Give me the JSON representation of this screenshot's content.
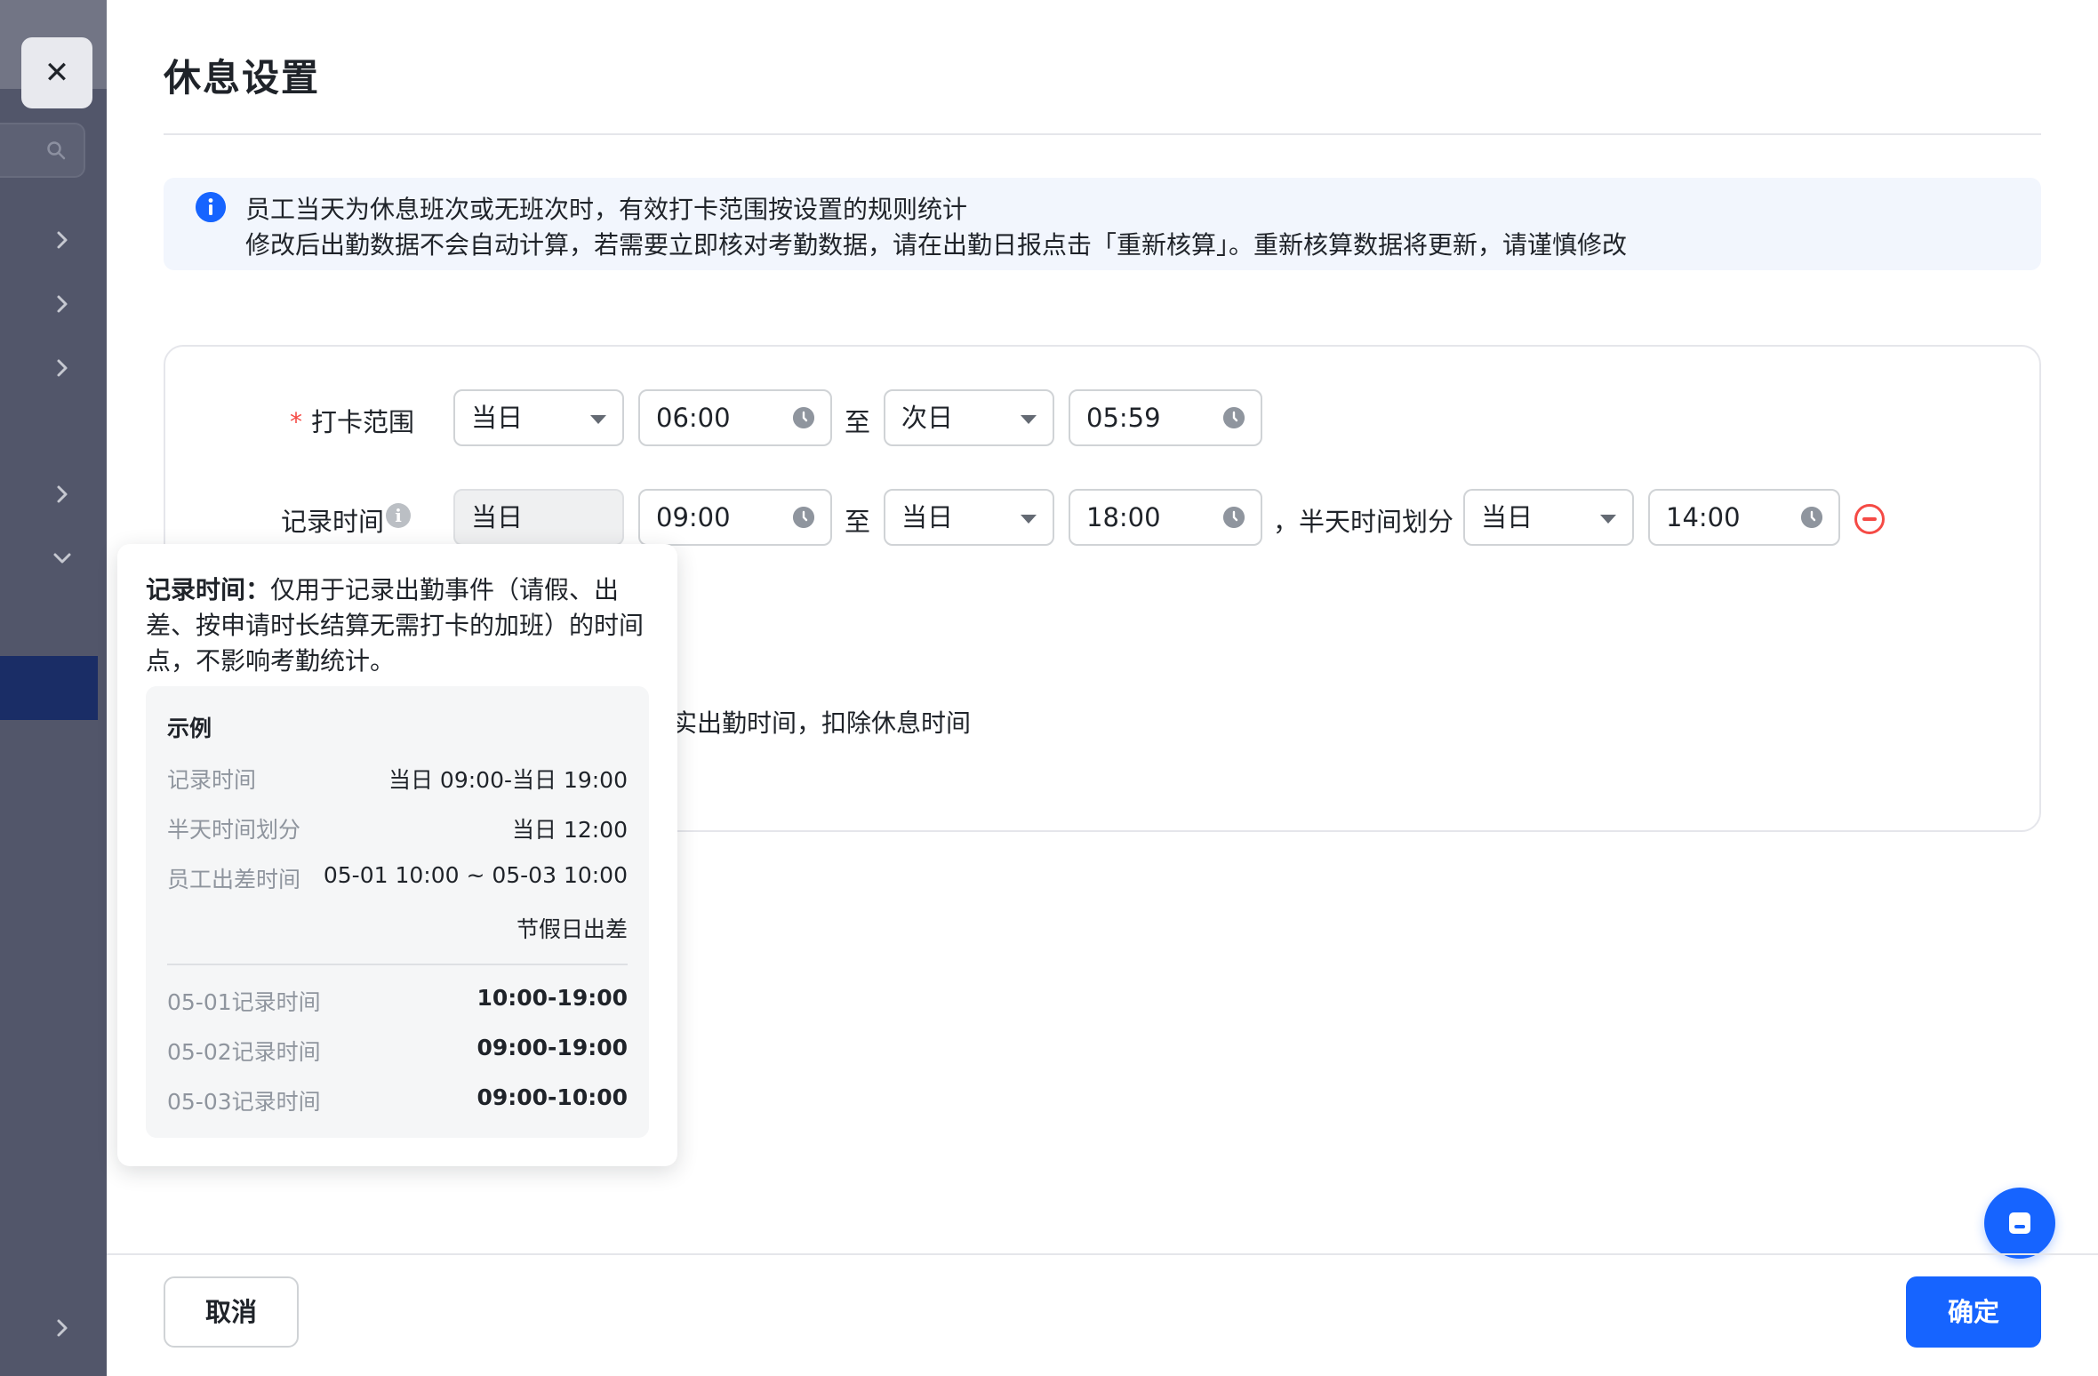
{
  "page": {
    "title": "休息设置",
    "close_glyph": "✕"
  },
  "notice": {
    "line1": "员工当天为休息班次或无班次时，有效打卡范围按设置的规则统计",
    "line2": "修改后出勤数据不会自动计算，若需要立即核对考勤数据，请在出勤日报点击「重新核算」。重新核算数据将更新，请谨慎修改"
  },
  "form": {
    "punch_range": {
      "required_mark": "*",
      "label": "打卡范围",
      "start_day": "当日",
      "start_time": "06:00",
      "to": "至",
      "end_day": "次日",
      "end_time": "05:59"
    },
    "record_time": {
      "label": "记录时间",
      "help_glyph": "i",
      "start_day": "当日",
      "start_time": "09:00",
      "to": "至",
      "end_day": "当日",
      "end_time": "18:00",
      "half_day_label": "，半天时间划分",
      "half_day": "当日",
      "half_time": "14:00"
    },
    "partial_text": "实出勤时间，扣除休息时间"
  },
  "tooltip": {
    "title": "记录时间：",
    "desc": "仅用于记录出勤事件（请假、出差、按申请时长结算无需打卡的加班）的时间点，不影响考勤统计。",
    "example_title": "示例",
    "rows": [
      {
        "k": "记录时间",
        "v": "当日 09:00-当日 19:00"
      },
      {
        "k": "半天时间划分",
        "v": "当日 12:00"
      },
      {
        "k": "员工出差时间",
        "v": "05-01 10:00 ~ 05-03 10:00"
      },
      {
        "k": "",
        "v": "节假日出差"
      }
    ],
    "results": [
      {
        "k": "05-01记录时间",
        "v": "10:00-19:00"
      },
      {
        "k": "05-02记录时间",
        "v": "09:00-19:00"
      },
      {
        "k": "05-03记录时间",
        "v": "09:00-10:00"
      }
    ]
  },
  "footer": {
    "cancel": "取消",
    "confirm": "确定"
  },
  "colors": {
    "primary": "#1664ff",
    "danger": "#f54a45",
    "sidebar_overlay": "#52566a"
  }
}
